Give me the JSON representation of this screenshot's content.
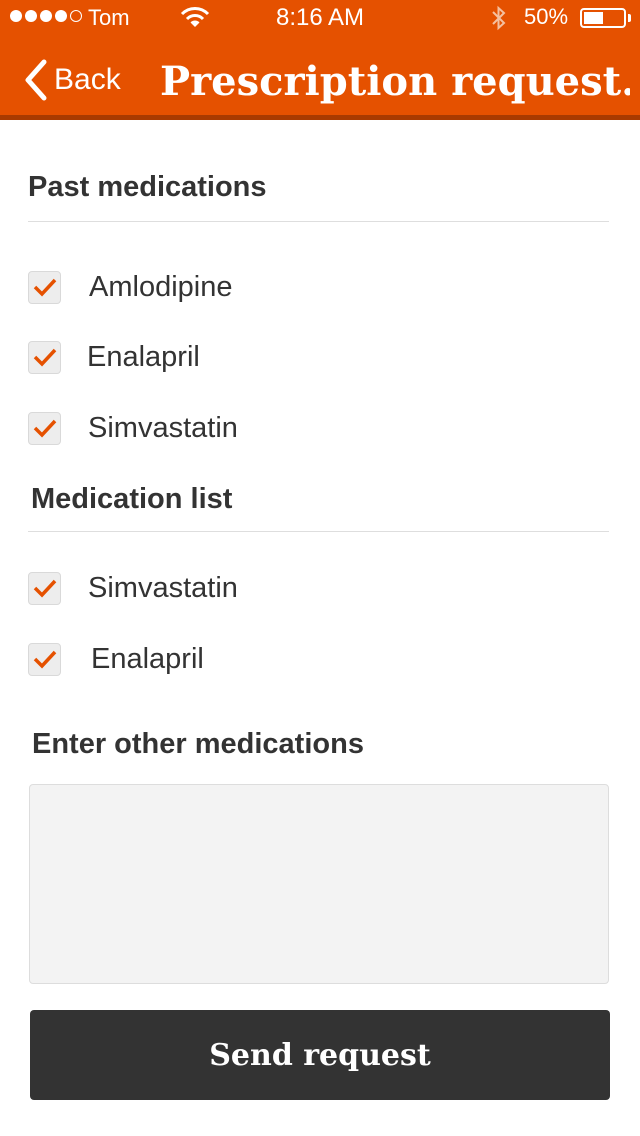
{
  "status_bar": {
    "carrier": "Tom",
    "time": "8:16 AM",
    "battery_percent": "50%",
    "battery_level": 0.5,
    "signal_bars_filled": 4,
    "signal_bars_total": 5,
    "icons": [
      "wifi-icon",
      "bluetooth-icon",
      "battery-icon"
    ]
  },
  "nav": {
    "back_label": "Back",
    "title": "Prescription request..."
  },
  "past_medications": {
    "heading": "Past medications",
    "items": [
      {
        "label": "Amlodipine",
        "checked": true
      },
      {
        "label": "Enalapril",
        "checked": true
      },
      {
        "label": "Simvastatin",
        "checked": true
      }
    ]
  },
  "medication_list": {
    "heading": "Medication list",
    "items": [
      {
        "label": "Simvastatin",
        "checked": true
      },
      {
        "label": "Enalapril",
        "checked": true
      }
    ]
  },
  "other_medications": {
    "heading": "Enter other medications",
    "value": "",
    "placeholder": ""
  },
  "send_button_label": "Send request",
  "colors": {
    "accent": "#e55100",
    "accent_dark": "#a83a00",
    "button": "#333333",
    "text": "#333333"
  }
}
